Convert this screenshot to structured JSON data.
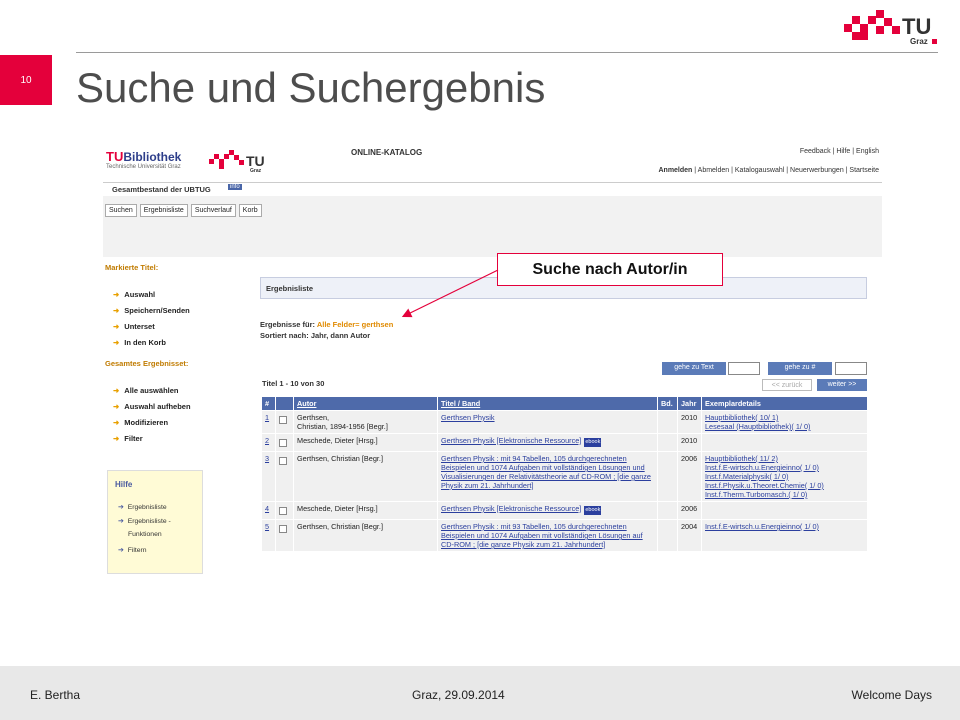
{
  "slide": {
    "number": "10",
    "title": "Suche und Suchergebnis",
    "logo_text": "TU",
    "logo_sub": "Graz"
  },
  "footer": {
    "left": "E. Bertha",
    "center": "Graz, 29.09.2014",
    "right": "Welcome  Days"
  },
  "callout": "Suche nach Autor/in",
  "colors": {
    "accent": "#e4003b",
    "header_blue": "#4e6aaa",
    "link": "#2b3f9e",
    "orange": "#c07b00"
  },
  "catalog": {
    "brand_tu": "TU",
    "brand_name": "Bibliothek",
    "brand_sub": "Technische Universität Graz",
    "mini_logo_text": "TU",
    "mini_logo_sub": "Graz",
    "header_title": "ONLINE-KATALOG",
    "top_links": "Feedback | Hilfe | English",
    "nav_anmelden": "Anmelden",
    "nav_rest": " | Abmelden | Katalogauswahl | Neuerwerbungen | Startseite",
    "gesamtbestand": "Gesamtbestand der UBTUG",
    "info_badge": "info",
    "tabs": [
      "Suchen",
      "Ergebnisliste",
      "Suchverlauf",
      "Korb"
    ],
    "sidebar": {
      "markierte": "Markierte Titel:",
      "markierte_items": [
        "Auswahl",
        "Speichern/Senden",
        "Unterset",
        "In den Korb"
      ],
      "gesamtes": "Gesamtes Ergebnisset:",
      "gesamtes_items": [
        "Alle auswählen",
        "Auswahl aufheben",
        "Modifizieren",
        "Filter"
      ],
      "hilfe_title": "Hilfe",
      "hilfe_items": [
        "Ergebnisliste",
        "Ergebnisliste -",
        "Funktionen",
        "Filtern"
      ]
    },
    "ergebnisliste": "Ergebnisliste",
    "ergebnisse_fuer_label": "Ergebnisse für: ",
    "ergebnisse_fuer_query": "Alle Felder= gerthsen",
    "sortiert": "Sortiert nach: Jahr, dann Autor",
    "goto_text": "gehe zu Text",
    "goto_num": "gehe zu #",
    "prev": "<< zurück",
    "next": "weiter >>",
    "titel_count": "Titel 1 - 10 von 30",
    "columns": [
      "#",
      "",
      "Autor",
      "Titel / Band",
      "Bd.",
      "Jahr",
      "Exemplardetails"
    ],
    "ebook_badge": "ebook",
    "rows": [
      {
        "num": "1",
        "author": "Gerthsen,\nChristian, 1894-1956 [Begr.]",
        "title": "Gerthsen Physik",
        "ebook": false,
        "bd": "",
        "year": "2010",
        "details": "Hauptbibliothek( 10/ 1)\nLesesaal (Hauptbibliothek)( 1/ 0)"
      },
      {
        "num": "2",
        "author": "Meschede, Dieter [Hrsg.]",
        "title": "Gerthsen Physik  [Elektronische Ressource]",
        "ebook": true,
        "bd": "",
        "year": "2010",
        "details": ""
      },
      {
        "num": "3",
        "author": "Gerthsen, Christian [Begr.]",
        "title": "Gerthsen Physik  : mit 94 Tabellen, 105 durchgerechneten Beispielen und 1074 Aufgaben mit vollständigen Lösungen und Visualisierungen der Relativitätstheorie auf CD-ROM ; [die ganze Physik zum 21. Jahrhundert]",
        "ebook": false,
        "bd": "",
        "year": "2006",
        "details": "Hauptbibliothek( 11/ 2)\nInst.f.E-wirtsch.u.Energieinno( 1/ 0)\nInst.f.Materialphysik( 1/ 0)\nInst.f.Physik.u.Theoret.Chemie( 1/ 0)\nInst.f.Therm.Turbomasch.( 1/ 0)"
      },
      {
        "num": "4",
        "author": "Meschede, Dieter [Hrsg.]",
        "title": "Gerthsen Physik  [Elektronische Ressource]",
        "ebook": true,
        "bd": "",
        "year": "2006",
        "details": ""
      },
      {
        "num": "5",
        "author": "Gerthsen, Christian [Begr.]",
        "title": "Gerthsen Physik  : mit 93 Tabellen, 105 durchgerechneten Beispielen und 1074 Aufgaben mit vollständigen Lösungen auf CD-ROM ; [die ganze Physik zum 21. Jahrhundert]",
        "ebook": false,
        "bd": "",
        "year": "2004",
        "details": "Inst.f.E-wirtsch.u.Energieinno( 1/ 0)"
      }
    ]
  }
}
